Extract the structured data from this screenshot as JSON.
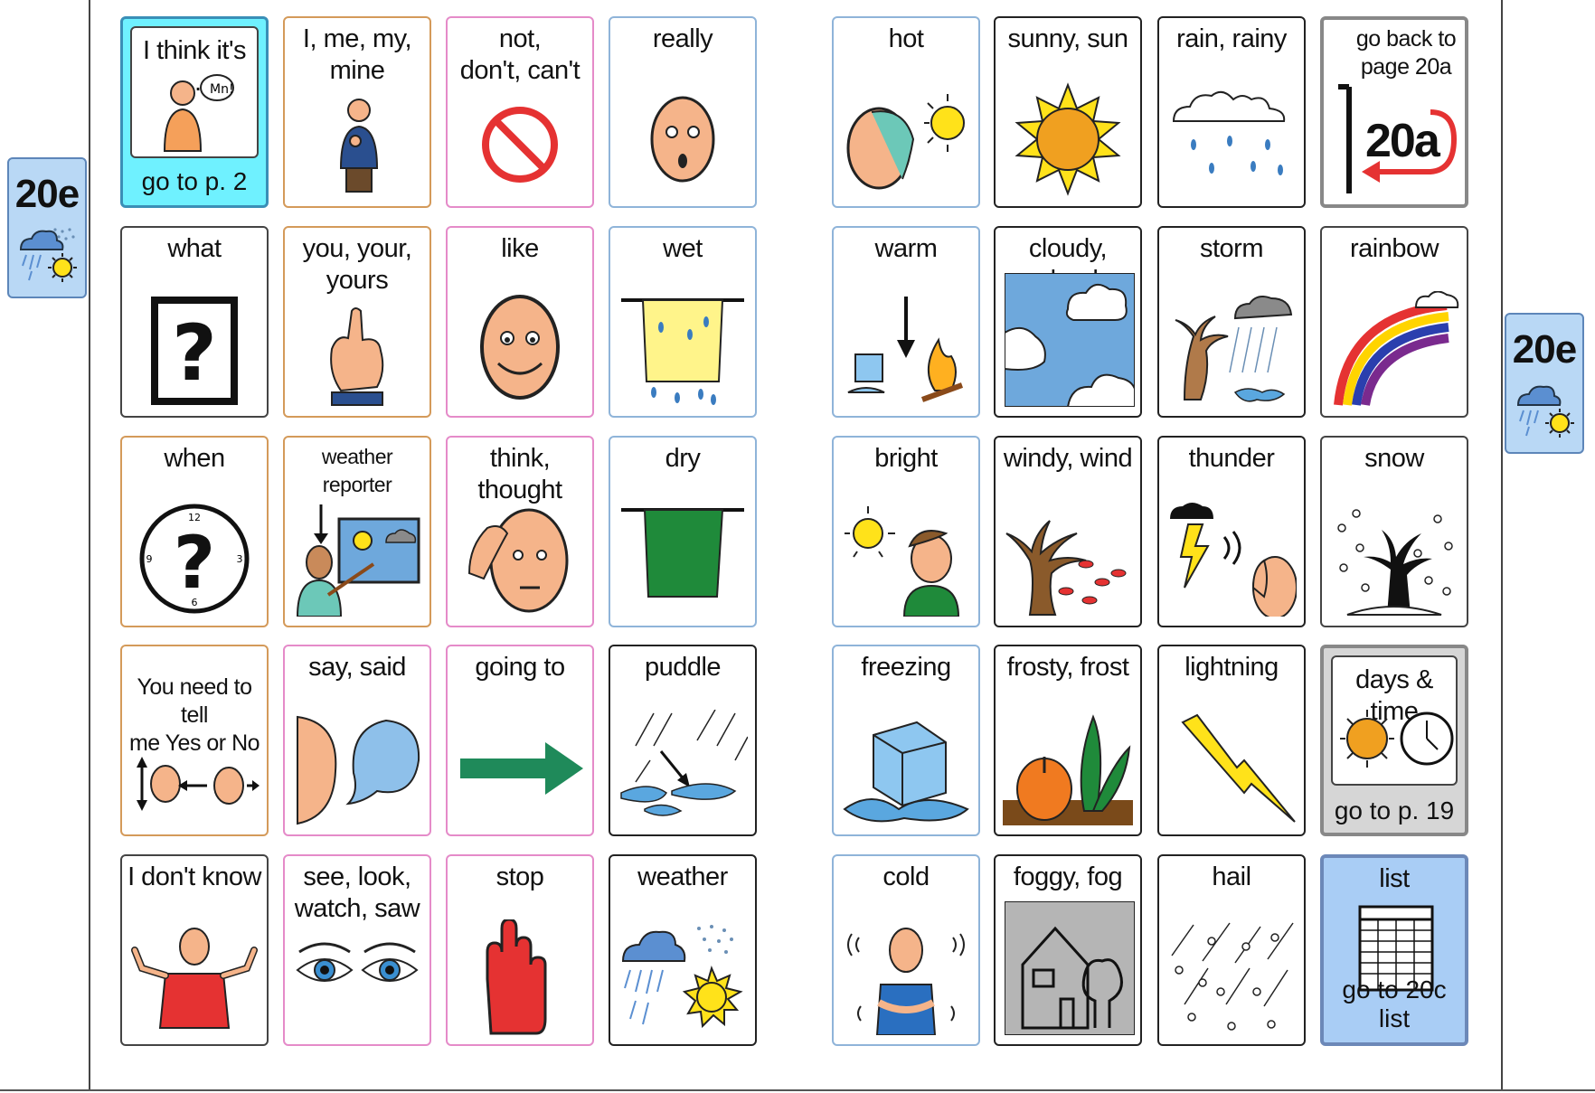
{
  "page_tabs": {
    "left": {
      "label": "20e",
      "icon": "weather-icon"
    },
    "right": {
      "label": "20e",
      "icon": "weather-icon"
    }
  },
  "grid": {
    "row1": [
      {
        "label": "I think it's ..",
        "link": "go to p. 2",
        "icon": "person-thinking-icon"
      },
      {
        "label": "I, me, my,\nmine",
        "icon": "person-pointing-self-icon"
      },
      {
        "label": "not,\ndon't, can't",
        "icon": "no-symbol-icon"
      },
      {
        "label": "really",
        "icon": "surprised-face-icon"
      },
      {
        "label": "hot",
        "icon": "hot-face-sun-icon"
      },
      {
        "label": "sunny,  sun",
        "icon": "sun-icon"
      },
      {
        "label": "rain,  rainy",
        "icon": "rain-cloud-icon"
      },
      {
        "label": "go back to\npage 20a",
        "badge": "20a",
        "icon": "back-arrow-icon"
      }
    ],
    "row2": [
      {
        "label": "what",
        "icon": "question-box-icon"
      },
      {
        "label": "you, your,\nyours",
        "icon": "pointing-hand-icon"
      },
      {
        "label": "like",
        "icon": "smiling-face-icon"
      },
      {
        "label": "wet",
        "icon": "wet-cloth-icon"
      },
      {
        "label": "warm",
        "icon": "ice-melting-fire-icon"
      },
      {
        "label": "cloudy,  cloud",
        "icon": "clouds-sky-icon"
      },
      {
        "label": "storm",
        "icon": "storm-icon"
      },
      {
        "label": "rainbow",
        "icon": "rainbow-icon"
      }
    ],
    "row3": [
      {
        "label": "when",
        "icon": "clock-question-icon"
      },
      {
        "label": "weather reporter",
        "icon": "weather-reporter-icon"
      },
      {
        "label": "think, thought",
        "icon": "thinking-face-icon"
      },
      {
        "label": "dry",
        "icon": "dry-cloth-icon"
      },
      {
        "label": "bright",
        "icon": "bright-sun-boy-icon"
      },
      {
        "label": "windy,  wind",
        "icon": "windy-tree-icon"
      },
      {
        "label": "thunder",
        "icon": "thunder-icon"
      },
      {
        "label": "snow",
        "icon": "snow-tree-icon"
      }
    ],
    "row4": [
      {
        "label": "You need to tell\nme Yes or No",
        "icon": "yes-no-heads-icon"
      },
      {
        "label": "say, said",
        "icon": "speech-bubble-icon"
      },
      {
        "label": "going to",
        "icon": "green-arrow-icon"
      },
      {
        "label": "puddle",
        "icon": "puddle-icon"
      },
      {
        "label": "freezing",
        "icon": "ice-cube-icon"
      },
      {
        "label": "frosty,  frost",
        "icon": "frost-plants-icon"
      },
      {
        "label": "lightning",
        "icon": "lightning-bolt-icon"
      },
      {
        "label": "days & time",
        "link": "go to p. 19",
        "icon": "sun-clock-icon"
      }
    ],
    "row5": [
      {
        "label": "I don't know",
        "icon": "shrug-person-icon"
      },
      {
        "label": "see, look,\nwatch, saw",
        "icon": "eyes-icon"
      },
      {
        "label": "stop",
        "icon": "stop-hand-icon"
      },
      {
        "label": "weather",
        "icon": "weather-icon"
      },
      {
        "label": "cold",
        "icon": "cold-person-icon"
      },
      {
        "label": "foggy,  fog",
        "icon": "foggy-house-icon"
      },
      {
        "label": "hail",
        "icon": "hail-icon"
      },
      {
        "label": "list",
        "link": "go to 20c list",
        "icon": "list-table-icon"
      }
    ]
  },
  "colors": {
    "cyan_link": "#6ff1ff",
    "grey_link": "#d6d6d6",
    "blue_link": "#a9cdf5",
    "tab_bg": "#b9d8f5"
  }
}
